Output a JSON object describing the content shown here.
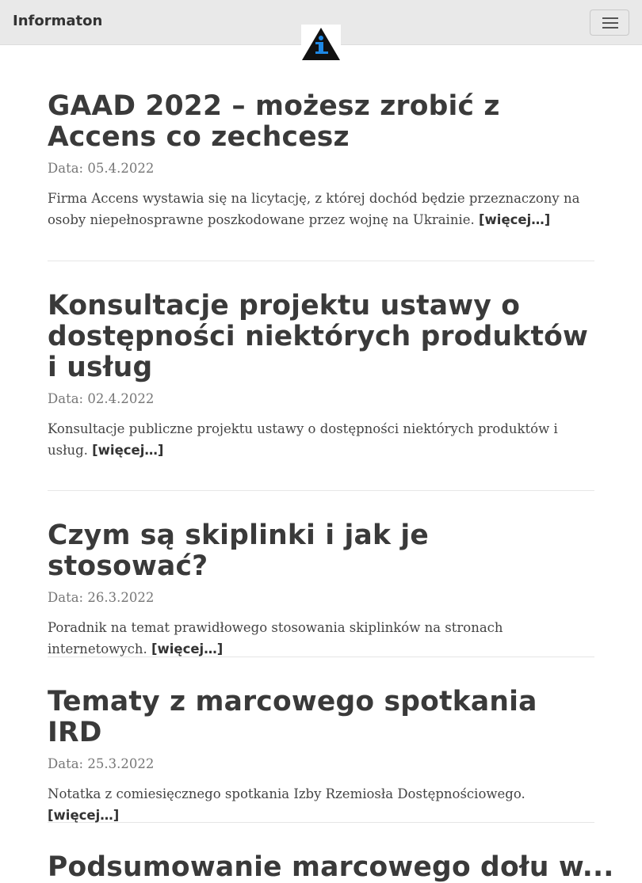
{
  "header": {
    "brand": "Informaton",
    "logo_icon": "info-triangle-logo",
    "menu_icon": "hamburger-menu-icon"
  },
  "articles": [
    {
      "title": "GAAD 2022 – możesz zrobić z Accens co zechcesz",
      "date": "Data: 05.4.2022",
      "excerpt": "Firma Accens wystawia się na licytację, z której dochód będzie przeznaczony na osoby niepełnosprawne poszkodowane przez wojnę na Ukrainie.",
      "more": "[więcej…]"
    },
    {
      "title": "Konsultacje projektu ustawy o dostępności niektórych produktów i usług",
      "date": "Data: 02.4.2022",
      "excerpt": "Konsultacje publiczne projektu ustawy o dostępności niektórych produktów i usług.",
      "more": "[więcej…]"
    },
    {
      "title": "Czym są skiplinki i jak je stosować?",
      "date": "Data: 26.3.2022",
      "excerpt": "Poradnik na temat prawidłowego stosowania skiplinków na stronach internetowych.",
      "more": "[więcej…]"
    },
    {
      "title": "Tematy z marcowego spotkania IRD",
      "date": "Data: 25.3.2022",
      "excerpt": "Notatka z comiesięcznego spotkania Izby Rzemiosła Dostępnościowego.",
      "more": "[więcej…]"
    },
    {
      "title": "Podsumowanie marcowego dołu w...",
      "date": "",
      "excerpt": "",
      "more": ""
    }
  ]
}
